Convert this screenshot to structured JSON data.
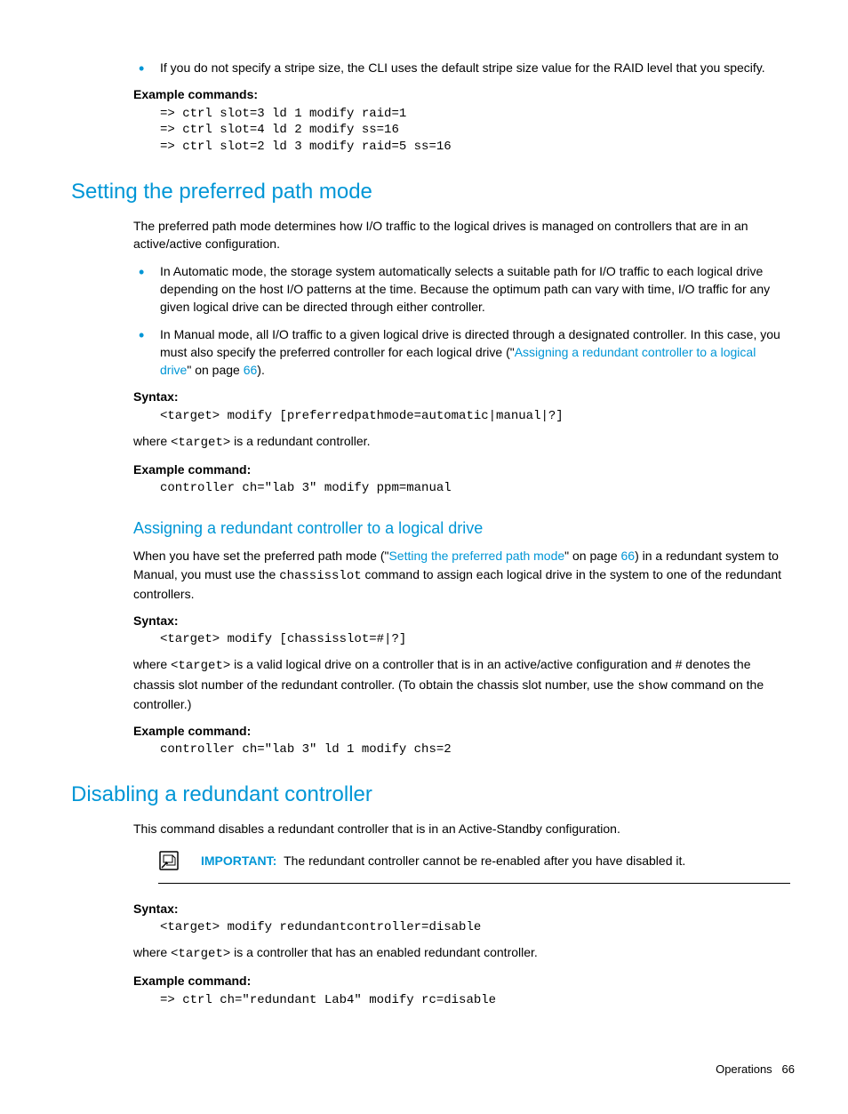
{
  "top_bullet": "If you do not specify a stripe size, the CLI uses the default stripe size value for the RAID level that you specify.",
  "example_commands_label": "Example commands:",
  "example_commands_top": "=> ctrl slot=3 ld 1 modify raid=1\n=> ctrl slot=4 ld 2 modify ss=16\n=> ctrl slot=2 ld 3 modify raid=5 ss=16",
  "section1": {
    "heading": "Setting the preferred path mode",
    "intro": "The preferred path mode determines how I/O traffic to the logical drives is managed on controllers that are in an active/active configuration.",
    "bullets": [
      "In Automatic mode, the storage system automatically selects a suitable path for I/O traffic to each logical drive depending on the host I/O patterns at the time. Because the optimum path can vary with time, I/O traffic for any given logical drive can be directed through either controller.",
      {
        "pre": "In Manual mode, all I/O traffic to a given logical drive is directed through a designated controller. In this case, you must also specify the preferred controller for each logical drive (\"",
        "link_text": "Assigning a redundant controller to a logical drive",
        "mid": "\" on page ",
        "page": "66",
        "post": ")."
      }
    ],
    "syntax_label": "Syntax:",
    "syntax_code": "<target> modify [preferredpathmode=automatic|manual|?]",
    "where_pre": "where ",
    "where_code": "<target>",
    "where_post": " is a redundant controller.",
    "example_label": "Example command:",
    "example_code": "controller ch=\"lab 3\" modify ppm=manual"
  },
  "section1b": {
    "heading": "Assigning a redundant controller to a logical drive",
    "para_pre": "When you have set the preferred path mode (\"",
    "para_link": "Setting the preferred path mode",
    "para_mid": "\" on page ",
    "para_page": "66",
    "para_post1": ") in a redundant system to Manual, you must use the ",
    "para_code": "chassisslot",
    "para_post2": " command to assign each logical drive in the system to one of the redundant controllers.",
    "syntax_label": "Syntax:",
    "syntax_code": "<target> modify [chassisslot=#|?]",
    "where_pre": "where ",
    "where_code1": "<target>",
    "where_mid": " is a valid logical drive on a controller that is in an active/active configuration and # denotes the chassis slot number of the redundant controller. (To obtain the chassis slot number, use the ",
    "where_code2": "show",
    "where_post": " command on the controller.)",
    "example_label": "Example command:",
    "example_code": "controller ch=\"lab 3\" ld 1 modify chs=2"
  },
  "section2": {
    "heading": "Disabling a redundant controller",
    "intro": "This command disables a redundant controller that is in an Active-Standby configuration.",
    "important_label": "IMPORTANT:",
    "important_text": "The redundant controller cannot be re-enabled after you have disabled it.",
    "syntax_label": "Syntax:",
    "syntax_code": "<target> modify redundantcontroller=disable",
    "where_pre": "where ",
    "where_code": "<target>",
    "where_post": " is a controller that has an enabled redundant controller.",
    "example_label": "Example command:",
    "example_code": "=> ctrl ch=\"redundant Lab4\" modify rc=disable"
  },
  "footer": {
    "section": "Operations",
    "page": "66"
  }
}
